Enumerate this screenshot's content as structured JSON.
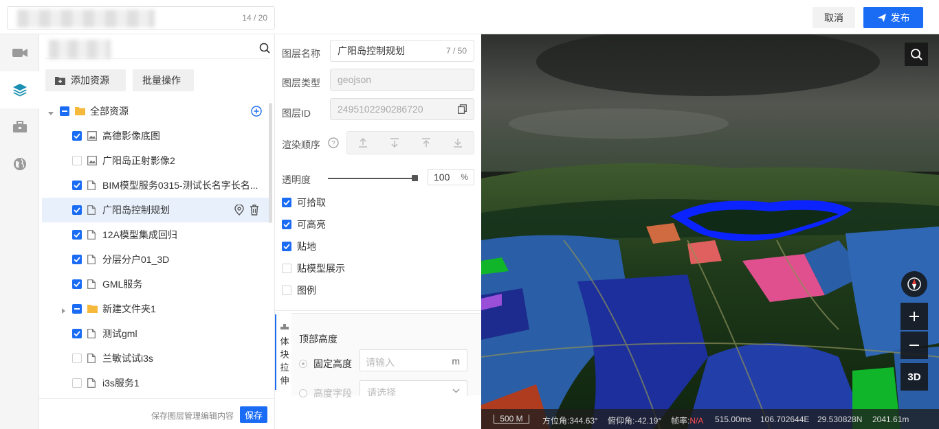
{
  "header": {
    "title_count": "14 / 20",
    "cancel_label": "取消",
    "publish_label": "发布"
  },
  "rail": {
    "items": [
      {
        "icon": "video-camera-icon"
      },
      {
        "icon": "layers-icon",
        "active": true
      },
      {
        "icon": "toolbox-icon"
      },
      {
        "icon": "globe-icon"
      }
    ]
  },
  "tree": {
    "add_resource_label": "添加资源",
    "batch_label": "批量操作",
    "nodes": [
      {
        "label": "全部资源",
        "type": "folder",
        "state": "indeterminate",
        "expanded": true
      },
      {
        "label": "高德影像底图",
        "type": "image",
        "state": "checked"
      },
      {
        "label": "广阳岛正射影像2",
        "type": "image",
        "state": "unchecked"
      },
      {
        "label": "BIM模型服务0315-测试长名字长名...",
        "type": "file",
        "state": "checked"
      },
      {
        "label": "广阳岛控制规划",
        "type": "file",
        "state": "checked",
        "selected": true
      },
      {
        "label": "12A模型集成回归",
        "type": "file",
        "state": "checked"
      },
      {
        "label": "分层分户01_3D",
        "type": "file",
        "state": "checked"
      },
      {
        "label": "GML服务",
        "type": "file",
        "state": "checked"
      },
      {
        "label": "新建文件夹1",
        "type": "folder",
        "state": "indeterminate",
        "expanded": false
      },
      {
        "label": "测试gml",
        "type": "file",
        "state": "checked"
      },
      {
        "label": "兰敏试试i3s",
        "type": "file",
        "state": "unchecked"
      },
      {
        "label": "i3s服务1",
        "type": "file",
        "state": "unchecked"
      }
    ],
    "footer_text": "保存图层管理编辑内容",
    "save_label": "保存"
  },
  "props": {
    "name_label": "图层名称",
    "name_value": "广阳岛控制规划",
    "name_count": "7 / 50",
    "type_label": "图层类型",
    "type_value": "geojson",
    "id_label": "图层ID",
    "id_value": "2495102290286720",
    "order_label": "渲染顺序",
    "opacity_label": "透明度",
    "opacity_value": "100",
    "opacity_unit": "%",
    "opacity_level": 1.0,
    "checks": [
      {
        "label": "可拾取",
        "checked": true
      },
      {
        "label": "可高亮",
        "checked": true
      },
      {
        "label": "贴地",
        "checked": true
      },
      {
        "label": "贴模型展示",
        "checked": false
      },
      {
        "label": "图例",
        "checked": false
      }
    ],
    "extrude": {
      "tab_chars": [
        "体",
        "块",
        "拉",
        "伸"
      ],
      "top_height_label": "顶部高度",
      "fixed_height_label": "固定高度",
      "fixed_height_placeholder": "请输入",
      "unit": "m",
      "field_label": "高度字段",
      "field_placeholder": "请选择"
    }
  },
  "map": {
    "scale": "500 M",
    "heading": "方位角:344.63°",
    "pitch": "俯仰角:-42.19°",
    "fps_label": "帧率:",
    "fps_value": "N/A",
    "latency": "515.00ms",
    "lon": "106.702644E",
    "lat": "29.530828N",
    "altitude": "2041.61m",
    "btn_3d": "3D",
    "colors": {
      "accent": "#1a6cf5",
      "status_red": "#ff4d4f"
    }
  }
}
